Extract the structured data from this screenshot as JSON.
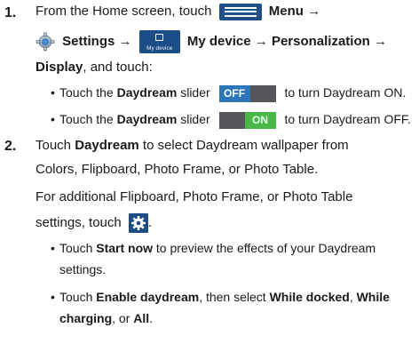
{
  "step1": {
    "number": "1.",
    "from_home": "From the Home screen, touch",
    "menu": "Menu",
    "arrow": "→",
    "settings": "Settings",
    "my_device": "My device",
    "my_device_icon_label": "My device",
    "personalization": "Personalization",
    "display": "Display",
    "and_touch": ", and touch:",
    "bullets": [
      {
        "pre": "Touch the ",
        "bold": "Daydream",
        "mid": " slider ",
        "toggle": "OFF",
        "post": "to turn Daydream ON."
      },
      {
        "pre": "Touch the ",
        "bold": "Daydream",
        "mid": " slider ",
        "toggle": "ON",
        "post": "to turn Daydream OFF."
      }
    ]
  },
  "step2": {
    "number": "2.",
    "touch": "Touch ",
    "daydream": "Daydream",
    "line1_rest": " to select Daydream wallpaper from",
    "line2": "Colors, Flipboard, Photo Frame, or Photo Table.",
    "line3": "For additional Flipboard, Photo Frame, or Photo Table",
    "line4": "settings, touch",
    "line4_end": ".",
    "bullet1_pre": "Touch ",
    "bullet1_bold": "Start now",
    "bullet1_post": " to preview the effects of your Daydream",
    "bullet1_cont": "settings.",
    "bullet2_pre": "Touch ",
    "bullet2_bold1": "Enable daydream",
    "bullet2_mid": ", then select ",
    "bullet2_bold2": "While docked",
    "bullet2_sep": ", ",
    "bullet2_bold3": "While",
    "bullet2_cont_bold": "charging",
    "bullet2_cont_mid": ", or ",
    "bullet2_cont_bold2": "All",
    "bullet2_cont_end": "."
  },
  "colors": {
    "icon_blue": "#1c4d87",
    "toggle_on": "#48b648",
    "toggle_off": "#2e75b7"
  },
  "icons": [
    "menu-icon",
    "gear-icon",
    "my-device-icon",
    "toggle-off-icon",
    "toggle-on-icon",
    "settings-gear-icon"
  ]
}
